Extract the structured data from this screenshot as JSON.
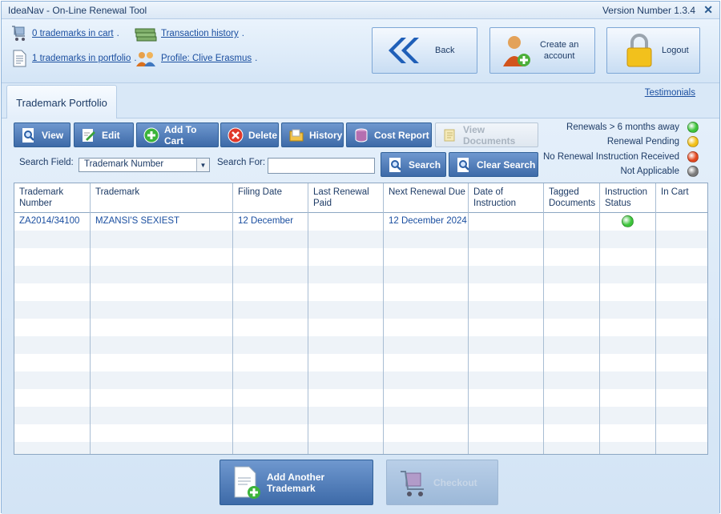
{
  "window": {
    "title": "IdeaNav - On-Line Renewal Tool",
    "version": "Version Number 1.3.4",
    "close_glyph": "✕"
  },
  "top_links": {
    "cart": "0 trademarks in cart",
    "portfolio": "1 trademarks in portfolio",
    "transactions": "Transaction history",
    "profile": "Profile: Clive Erasmus",
    "dot": "."
  },
  "big_buttons": {
    "back": "Back",
    "create_line1": "Create an",
    "create_line2": "account",
    "logout": "Logout"
  },
  "tabs": {
    "active": "Trademark Portfolio",
    "testimonials": "Testimonials"
  },
  "toolbar": {
    "view": "View",
    "edit": "Edit",
    "add_to_cart": "Add To Cart",
    "delete": "Delete",
    "history": "History",
    "cost_report": "Cost Report",
    "view_documents": "View Documents"
  },
  "legend": [
    {
      "label": "Renewals > 6 months away",
      "color": "#3cc43a"
    },
    {
      "label": "Renewal Pending",
      "color": "#f2c018"
    },
    {
      "label": "No Renewal Instruction Received",
      "color": "#e2471f"
    },
    {
      "label": "Not Applicable",
      "color": "#7a7a7a"
    }
  ],
  "search": {
    "field_label": "Search Field:",
    "field_value": "Trademark Number",
    "for_label": "Search For:",
    "search_button": "Search",
    "clear_button": "Clear Search"
  },
  "table": {
    "headers": [
      [
        "Trademark",
        "Number"
      ],
      [
        "Trademark",
        ""
      ],
      [
        "Filing Date",
        ""
      ],
      [
        "Last Renewal",
        "Paid"
      ],
      [
        "Next Renewal Due",
        ""
      ],
      [
        "Date of",
        "Instruction"
      ],
      [
        "Tagged",
        "Documents"
      ],
      [
        "Instruction",
        "Status"
      ],
      [
        "In Cart",
        ""
      ]
    ],
    "rows": [
      {
        "number": "ZA2014/34100",
        "trademark": "MZANSI'S SEXIEST",
        "filing_date": "12 December",
        "last_renewal": "",
        "next_renewal": "12 December 2024",
        "date_instruction": "",
        "tagged_docs": "",
        "status_color": "#3cc43a",
        "in_cart": ""
      }
    ]
  },
  "bottom": {
    "add_another": "Add Another Trademark",
    "checkout": "Checkout"
  }
}
